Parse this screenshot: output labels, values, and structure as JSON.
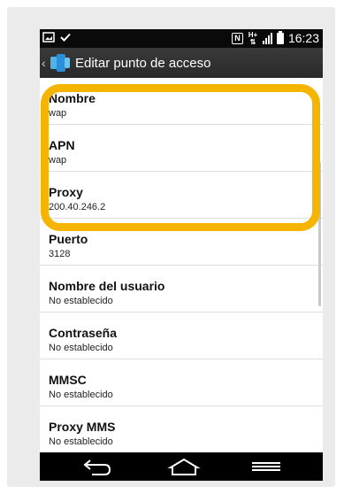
{
  "status_bar": {
    "time": "16:23",
    "icons": [
      "screen-icon",
      "check-icon",
      "nfc-icon",
      "hplus-icon",
      "signal-icon",
      "battery-icon"
    ]
  },
  "action_bar": {
    "title": "Editar punto de acceso"
  },
  "settings": [
    {
      "label": "Nombre",
      "value": "wap"
    },
    {
      "label": "APN",
      "value": "wap"
    },
    {
      "label": "Proxy",
      "value": "200.40.246.2"
    },
    {
      "label": "Puerto",
      "value": "3128"
    },
    {
      "label": "Nombre del usuario",
      "value": "No establecido"
    },
    {
      "label": "Contraseña",
      "value": "No establecido"
    },
    {
      "label": "MMSC",
      "value": "No establecido"
    },
    {
      "label": "Proxy MMS",
      "value": "No establecido"
    }
  ],
  "nav_bar": {
    "icons": [
      "back-icon",
      "home-icon",
      "menu-icon"
    ]
  },
  "colors": {
    "highlight": "#f5b400",
    "status_bar": "#0a0a0a",
    "action_bar": "#2f2f2f",
    "nav_bar": "#000000"
  }
}
